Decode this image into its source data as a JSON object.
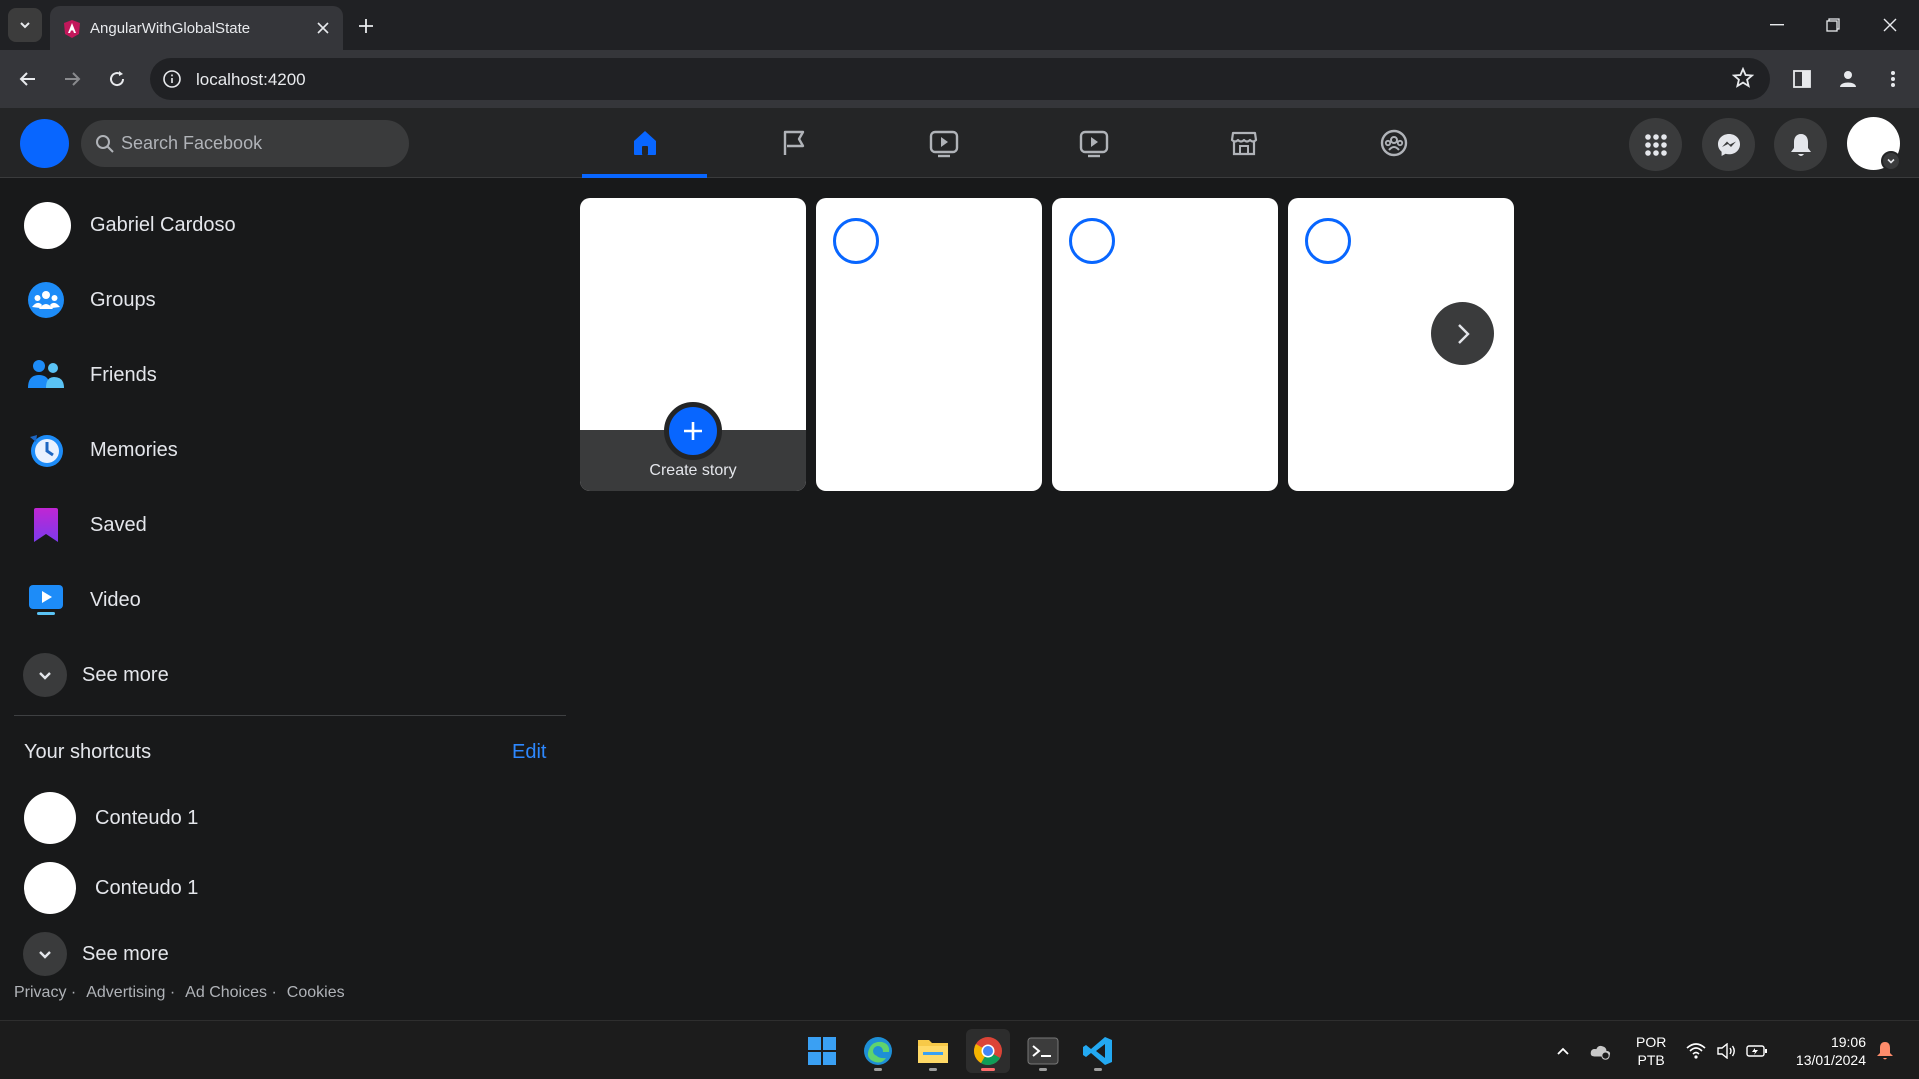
{
  "browser": {
    "tab_title": "AngularWithGlobalState",
    "url": "localhost:4200"
  },
  "header": {
    "search_placeholder": "Search Facebook",
    "nav_tabs": [
      "home",
      "pages",
      "watch",
      "video",
      "marketplace",
      "groups"
    ],
    "active_tab": "home",
    "accent_color": "#0866ff"
  },
  "sidebar": {
    "profile_name": "Gabriel Cardoso",
    "items": [
      {
        "label": "Groups",
        "icon": "groups-icon"
      },
      {
        "label": "Friends",
        "icon": "friends-icon"
      },
      {
        "label": "Memories",
        "icon": "memories-icon"
      },
      {
        "label": "Saved",
        "icon": "saved-icon"
      },
      {
        "label": "Video",
        "icon": "video-icon"
      }
    ],
    "see_more": "See more",
    "shortcuts_title": "Your shortcuts",
    "shortcuts_edit": "Edit",
    "shortcuts": [
      {
        "label": "Conteudo 1"
      },
      {
        "label": "Conteudo 1"
      }
    ],
    "shortcuts_see_more": "See more",
    "footer": [
      "Privacy",
      "Advertising",
      "Ad Choices",
      "Cookies"
    ]
  },
  "stories": {
    "create_label": "Create story"
  },
  "taskbar": {
    "lang_line1": "POR",
    "lang_line2": "PTB",
    "time": "19:06",
    "date": "13/01/2024"
  }
}
